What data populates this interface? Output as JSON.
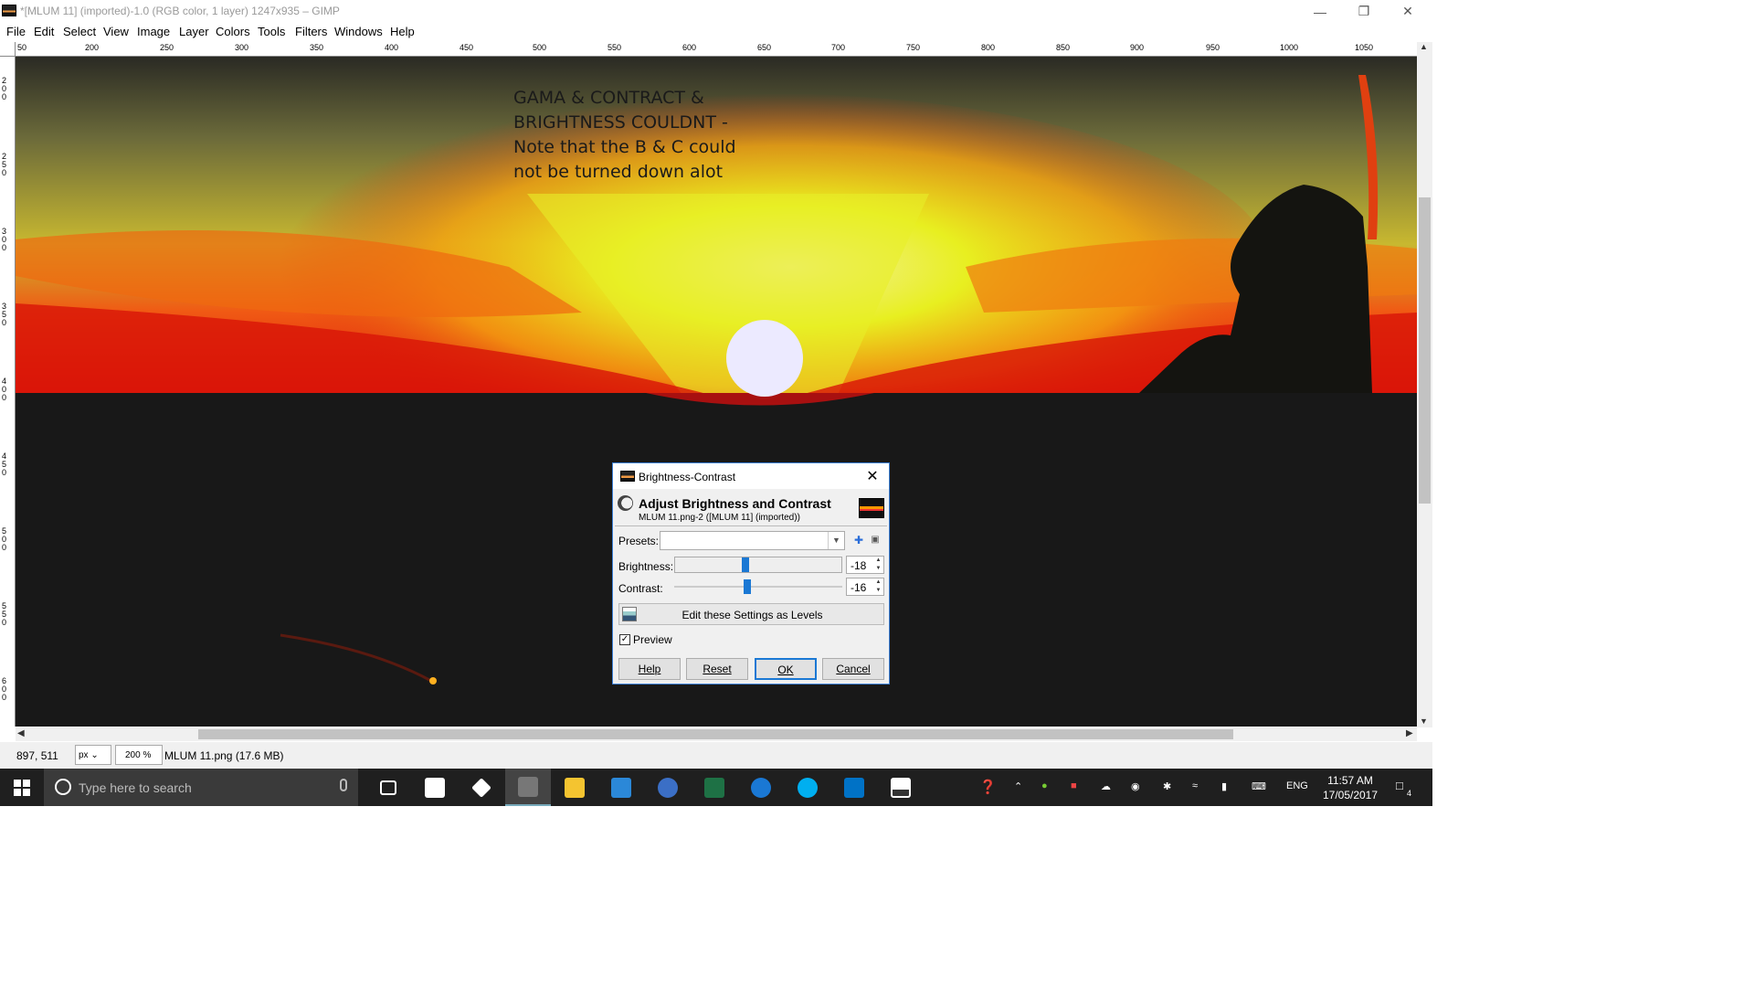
{
  "window": {
    "title": "*[MLUM 11] (imported)-1.0 (RGB color, 1 layer) 1247x935 – GIMP",
    "controls": [
      "minimize",
      "restore",
      "close"
    ]
  },
  "menu": [
    "File",
    "Edit",
    "Select",
    "View",
    "Image",
    "Layer",
    "Colors",
    "Tools",
    "Filters",
    "Windows",
    "Help"
  ],
  "ruler": {
    "h_labels": [
      "50",
      "200",
      "250",
      "300",
      "350",
      "400",
      "450",
      "500",
      "550",
      "600",
      "650",
      "700",
      "750",
      "800",
      "850",
      "900",
      "950",
      "1000",
      "1050"
    ],
    "v_labels": [
      "200",
      "250",
      "300",
      "350",
      "400",
      "450",
      "500",
      "550",
      "600"
    ]
  },
  "canvas": {
    "note_lines": [
      "GAMA & CONTRACT &",
      "BRIGHTNESS COULDNT -",
      "Note that the B & C could",
      "not be turned down alot"
    ]
  },
  "dialog": {
    "title": "Brightness-Contrast",
    "heading": "Adjust Brightness and Contrast",
    "subheading": "MLUM 11.png-2 ([MLUM 11] (imported))",
    "presets_label": "Presets:",
    "presets_value": "",
    "brightness_label": "Brightness:",
    "brightness_value": "-18",
    "brightness_fraction": 0.42,
    "contrast_label": "Contrast:",
    "contrast_value": "-16",
    "contrast_fraction": 0.43,
    "levels_button": "Edit these Settings as Levels",
    "preview_label": "Preview",
    "preview_checked": true,
    "buttons": {
      "help": "Help",
      "reset": "Reset",
      "ok": "OK",
      "cancel": "Cancel"
    },
    "accent": "#1a78d4"
  },
  "status": {
    "coords": "897, 511",
    "unit": "px",
    "zoom": "200 %",
    "file": "MLUM 11.png (17.6 MB)"
  },
  "taskbar": {
    "search_placeholder": "Type here to search",
    "apps": [
      "task-view",
      "store",
      "dropbox",
      "gimp",
      "file-explorer",
      "sway",
      "google-earth",
      "excel",
      "edge",
      "skype",
      "outlook",
      "photos"
    ],
    "language": "ENG",
    "time": "11:57 AM",
    "date": "17/05/2017",
    "notification_count": "4"
  }
}
